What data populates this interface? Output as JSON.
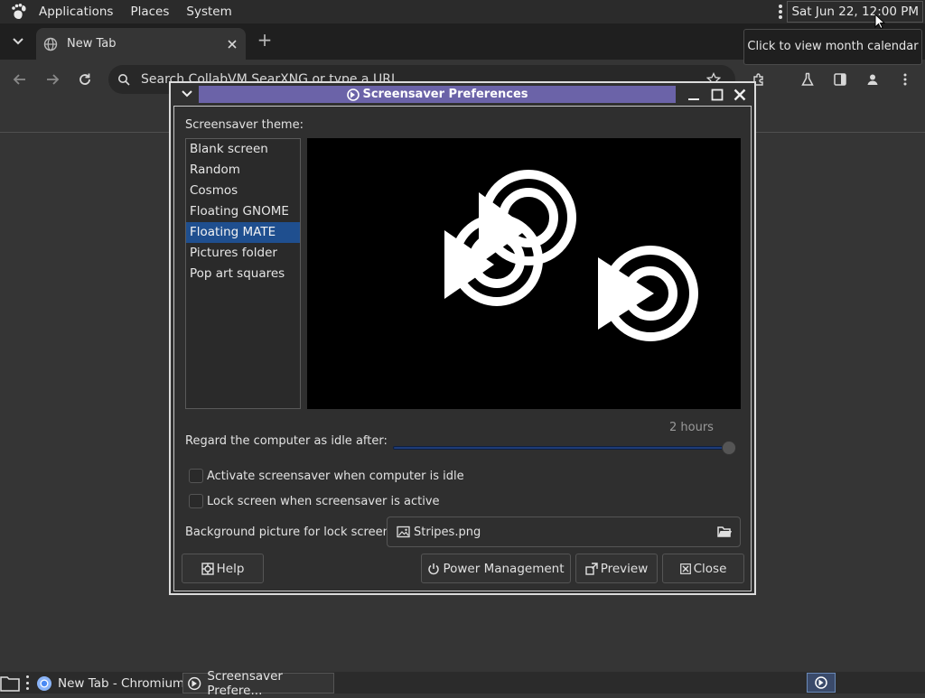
{
  "panel": {
    "menus": [
      "Applications",
      "Places",
      "System"
    ],
    "clock": "Sat Jun 22, 12:00 PM",
    "tooltip": "Click to view month calendar"
  },
  "browser": {
    "tab_title": "New Tab",
    "omnibox_placeholder": "Search CollabVM SearXNG or type a URL"
  },
  "dialog": {
    "title": "Screensaver Preferences",
    "theme_label": "Screensaver theme:",
    "themes": [
      "Blank screen",
      "Random",
      "Cosmos",
      "Floating GNOME",
      "Floating MATE",
      "Pictures folder",
      "Pop art squares"
    ],
    "selected_theme_index": 4,
    "idle_label": "Regard the computer as idle after:",
    "idle_value": "2 hours",
    "idle_fraction": 1.0,
    "activate_label": "Activate screensaver when computer is idle",
    "activate_checked": false,
    "lock_label": "Lock screen when screensaver is active",
    "lock_checked": false,
    "bg_label": "Background picture for lock screen:",
    "bg_file": "Stripes.png",
    "buttons": {
      "help": "Help",
      "power": "Power Management",
      "preview": "Preview",
      "close": "Close"
    }
  },
  "taskbar": {
    "tasks": [
      "New Tab - Chromium",
      "Screensaver Prefere..."
    ]
  },
  "colors": {
    "title_band": "#6b63a8",
    "selection": "#1f4f8f",
    "slider_fill": "#1e3c78"
  }
}
